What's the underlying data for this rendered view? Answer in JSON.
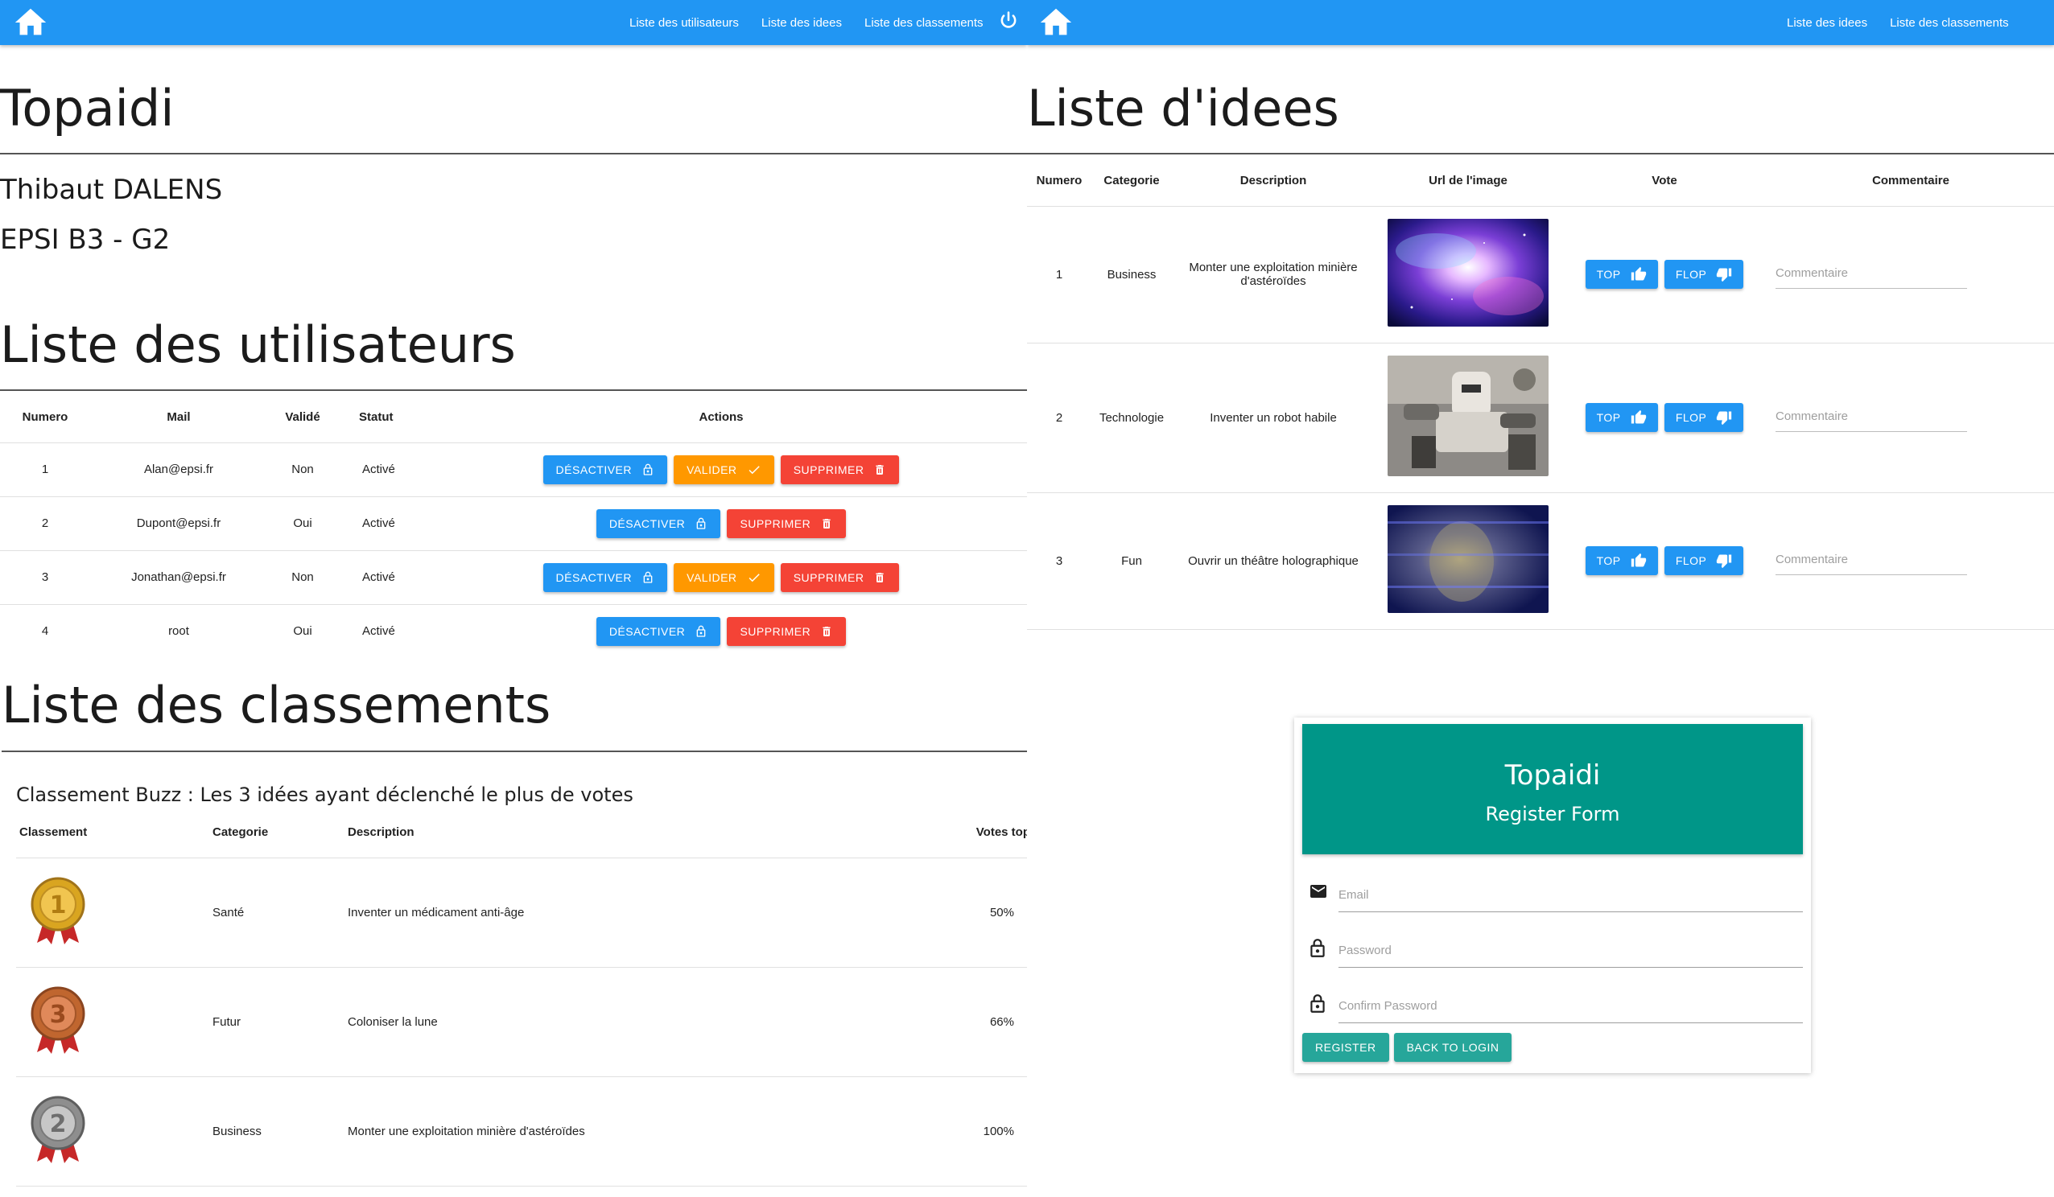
{
  "left_nav": {
    "links": [
      "Liste des utilisateurs",
      "Liste des idees",
      "Liste des classements"
    ]
  },
  "right_nav": {
    "links": [
      "Liste des idees",
      "Liste des classements"
    ]
  },
  "header": {
    "title": "Topaidi",
    "author": "Thibaut DALENS",
    "group": "EPSI B3 - G2"
  },
  "users": {
    "title": "Liste des utilisateurs",
    "columns": [
      "Numero",
      "Mail",
      "Validé",
      "Statut",
      "Actions"
    ],
    "rows": [
      {
        "num": "1",
        "mail": "Alan@epsi.fr",
        "valide": "Non",
        "statut": "Activé",
        "actions": [
          "DÉSACTIVER",
          "VALIDER",
          "SUPPRIMER"
        ]
      },
      {
        "num": "2",
        "mail": "Dupont@epsi.fr",
        "valide": "Oui",
        "statut": "Activé",
        "actions": [
          "DÉSACTIVER",
          "SUPPRIMER"
        ]
      },
      {
        "num": "3",
        "mail": "Jonathan@epsi.fr",
        "valide": "Non",
        "statut": "Activé",
        "actions": [
          "DÉSACTIVER",
          "VALIDER",
          "SUPPRIMER"
        ]
      },
      {
        "num": "4",
        "mail": "root",
        "valide": "Oui",
        "statut": "Activé",
        "actions": [
          "DÉSACTIVER",
          "SUPPRIMER"
        ]
      }
    ]
  },
  "classements": {
    "title": "Liste des classements",
    "subtitle": "Classement Buzz : Les 3 idées ayant déclenché le plus de votes",
    "columns": [
      "Classement",
      "Categorie",
      "Description",
      "Votes top"
    ],
    "rows": [
      {
        "rank": "1",
        "medal": "gold-medal-icon",
        "categorie": "Santé",
        "description": "Inventer un médicament anti-âge",
        "votes": "50%"
      },
      {
        "rank": "3",
        "medal": "bronze-medal-icon",
        "categorie": "Futur",
        "description": "Coloniser la lune",
        "votes": "66%"
      },
      {
        "rank": "2",
        "medal": "silver-medal-icon",
        "categorie": "Business",
        "description": "Monter une exploitation minière d'astéroïdes",
        "votes": "100%"
      }
    ]
  },
  "idees": {
    "title": "Liste d'idees",
    "columns": [
      "Numero",
      "Categorie",
      "Description",
      "Url de l'image",
      "Vote",
      "Commentaire"
    ],
    "top_label": "TOP",
    "flop_label": "FLOP",
    "comment_placeholder": "Commentaire",
    "rows": [
      {
        "num": "1",
        "categorie": "Business",
        "description": "Monter une exploitation minière d'astéroïdes",
        "image": "galaxy-image"
      },
      {
        "num": "2",
        "categorie": "Technologie",
        "description": "Inventer un robot habile",
        "image": "robot-image"
      },
      {
        "num": "3",
        "categorie": "Fun",
        "description": "Ouvrir un théâtre holographique",
        "image": "hologram-image"
      }
    ]
  },
  "register": {
    "title": "Topaidi",
    "subtitle": "Register Form",
    "email_placeholder": "Email",
    "password_placeholder": "Password",
    "confirm_placeholder": "Confirm Password",
    "register_label": "REGISTER",
    "back_label": "BACK TO LOGIN"
  },
  "colors": {
    "nav": "#2196f3",
    "blue_button": "#2196f3",
    "orange_button": "#ff9800",
    "red_button": "#f44336",
    "register_header": "#009688",
    "teal_button": "#26a69a"
  }
}
